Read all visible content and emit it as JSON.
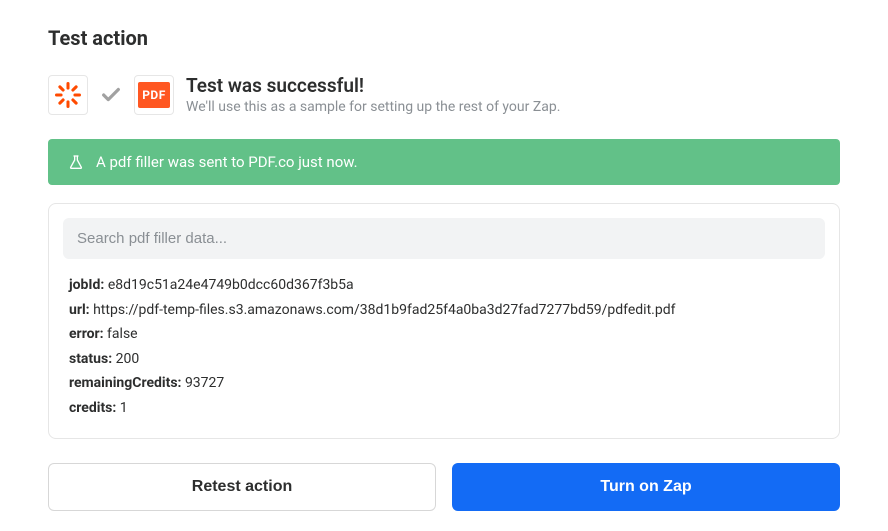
{
  "page_title": "Test action",
  "header": {
    "title": "Test was successful!",
    "subtitle": "We'll use this as a sample for setting up the rest of your Zap.",
    "app_pdf_label": "PDF"
  },
  "success_message": "A pdf filler was sent to PDF.co just now.",
  "search_placeholder": "Search pdf filler data...",
  "result": {
    "fields": [
      {
        "key": "jobId",
        "value": "e8d19c51a24e4749b0dcc60d367f3b5a"
      },
      {
        "key": "url",
        "value": "https://pdf-temp-files.s3.amazonaws.com/38d1b9fad25f4a0ba3d27fad7277bd59/pdfedit.pdf"
      },
      {
        "key": "error",
        "value": "false"
      },
      {
        "key": "status",
        "value": "200"
      },
      {
        "key": "remainingCredits",
        "value": "93727"
      },
      {
        "key": "credits",
        "value": "1"
      }
    ]
  },
  "buttons": {
    "retest": "Retest action",
    "turn_on": "Turn on Zap"
  }
}
